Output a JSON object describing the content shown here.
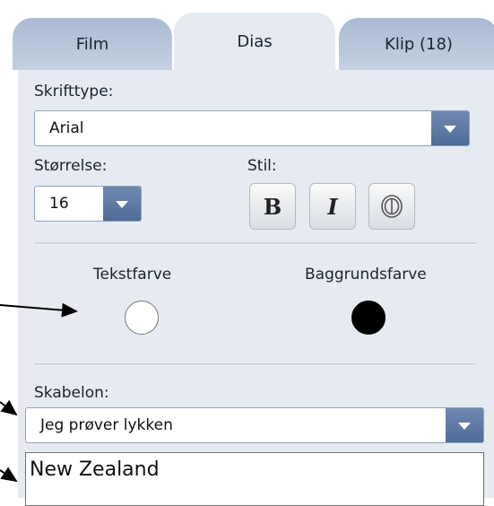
{
  "tabs": [
    {
      "label": "Film"
    },
    {
      "label": "Dias"
    },
    {
      "label": "Klip (18)"
    }
  ],
  "font": {
    "label": "Skrifttype:",
    "value": "Arial"
  },
  "size": {
    "label": "Størrelse:",
    "value": "16"
  },
  "style": {
    "label": "Stil:",
    "bold": "B",
    "italic": "I"
  },
  "colors": {
    "text_label": "Tekstfarve",
    "background_label": "Baggrundsfarve",
    "text_color": "#ffffff",
    "background_color": "#000000"
  },
  "template": {
    "label": "Skabelon:",
    "value": "Jeg prøver lykken"
  },
  "text_input": {
    "value": "New Zealand"
  },
  "accent_color": "#5a76a0"
}
